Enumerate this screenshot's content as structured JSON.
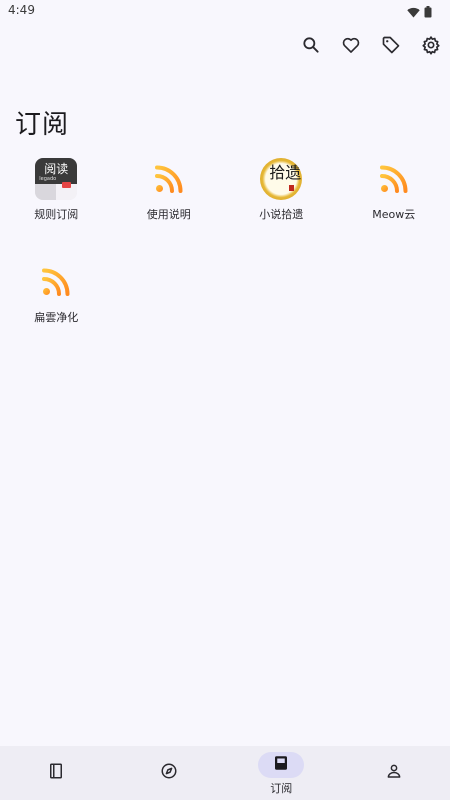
{
  "status_bar": {
    "time": "4:49",
    "icons": [
      "wifi-icon",
      "battery-icon"
    ]
  },
  "toolbar": {
    "actions": [
      {
        "name": "search",
        "icon": "search-icon"
      },
      {
        "name": "favorites",
        "icon": "heart-icon"
      },
      {
        "name": "tags",
        "icon": "tag-icon"
      },
      {
        "name": "settings",
        "icon": "gear-icon"
      }
    ]
  },
  "page": {
    "title": "订阅"
  },
  "sources": [
    {
      "label": "规则订阅",
      "icon": "reading-app-logo",
      "logo_text": "阅读",
      "logo_sub": "legado"
    },
    {
      "label": "使用说明",
      "icon": "rss-icon"
    },
    {
      "label": "小说拾遗",
      "icon": "calligraphy-logo",
      "logo_text": "拾遗"
    },
    {
      "label": "Meow云",
      "icon": "rss-icon"
    },
    {
      "label": "扁雲净化",
      "icon": "rss-icon"
    }
  ],
  "bottom_nav": {
    "items": [
      {
        "name": "bookshelf",
        "icon": "book-icon",
        "label": "",
        "active": false
      },
      {
        "name": "discover",
        "icon": "compass-icon",
        "label": "",
        "active": false
      },
      {
        "name": "subscribe",
        "icon": "subscription-icon",
        "label": "订阅",
        "active": true
      },
      {
        "name": "my",
        "icon": "person-icon",
        "label": "",
        "active": false
      }
    ]
  },
  "colors": {
    "background": "#f8f7fd",
    "rss_gradient_start": "#ffc53d",
    "rss_gradient_end": "#ff8a1f",
    "nav_background": "#eeedf4",
    "nav_active_pill": "#dcdbf5",
    "text_primary": "#1c1b1f"
  }
}
